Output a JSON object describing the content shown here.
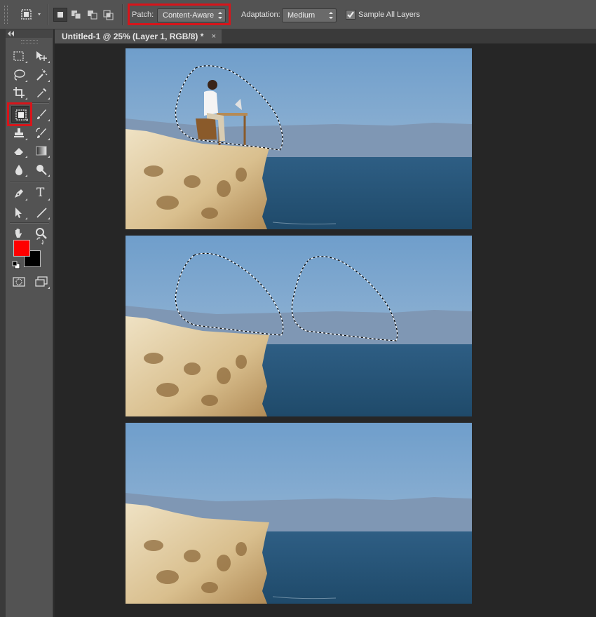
{
  "options_bar": {
    "patch_label": "Patch:",
    "patch_value": "Content-Aware",
    "adaptation_label": "Adaptation:",
    "adaptation_value": "Medium",
    "sample_all_layers_label": "Sample All Layers",
    "sample_all_layers_checked": true,
    "selection_modes": [
      "new-selection-icon",
      "add-to-selection-icon",
      "subtract-from-selection-icon",
      "intersect-selection-icon"
    ]
  },
  "document": {
    "tab_title": "Untitled-1 @ 25% (Layer 1, RGB/8) *",
    "close_glyph": "×"
  },
  "toolbox": {
    "tools": [
      "rectangular-marquee-icon",
      "move-icon",
      "lasso-icon",
      "magic-wand-icon",
      "crop-icon",
      "eyedropper-icon",
      "patch-tool-icon",
      "brush-icon",
      "clone-stamp-icon",
      "history-brush-icon",
      "eraser-icon",
      "gradient-icon",
      "blur-drop-icon",
      "dodge-icon",
      "pen-icon",
      "type-icon",
      "path-selection-icon",
      "line-icon",
      "hand-icon",
      "zoom-icon"
    ],
    "active_tool": "patch-tool-icon",
    "type_tool_glyph": "T",
    "foreground_color": "#ff0000",
    "background_color": "#000000"
  },
  "colors": {
    "highlight": "#d8141a",
    "panel": "#535353",
    "canvas_bg": "#262626"
  }
}
